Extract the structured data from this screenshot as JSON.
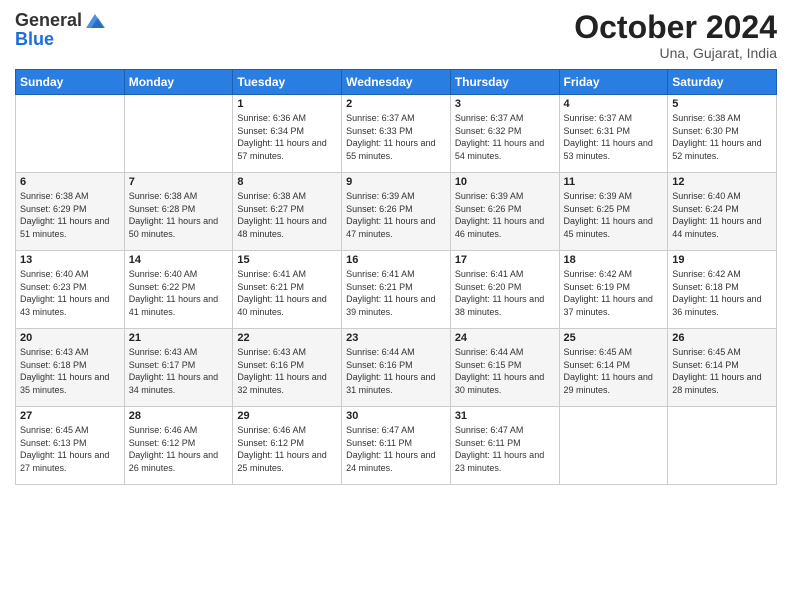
{
  "header": {
    "logo_line1": "General",
    "logo_line2": "Blue",
    "month": "October 2024",
    "location": "Una, Gujarat, India"
  },
  "weekdays": [
    "Sunday",
    "Monday",
    "Tuesday",
    "Wednesday",
    "Thursday",
    "Friday",
    "Saturday"
  ],
  "weeks": [
    [
      {
        "day": "",
        "sunrise": "",
        "sunset": "",
        "daylight": ""
      },
      {
        "day": "",
        "sunrise": "",
        "sunset": "",
        "daylight": ""
      },
      {
        "day": "1",
        "sunrise": "Sunrise: 6:36 AM",
        "sunset": "Sunset: 6:34 PM",
        "daylight": "Daylight: 11 hours and 57 minutes."
      },
      {
        "day": "2",
        "sunrise": "Sunrise: 6:37 AM",
        "sunset": "Sunset: 6:33 PM",
        "daylight": "Daylight: 11 hours and 55 minutes."
      },
      {
        "day": "3",
        "sunrise": "Sunrise: 6:37 AM",
        "sunset": "Sunset: 6:32 PM",
        "daylight": "Daylight: 11 hours and 54 minutes."
      },
      {
        "day": "4",
        "sunrise": "Sunrise: 6:37 AM",
        "sunset": "Sunset: 6:31 PM",
        "daylight": "Daylight: 11 hours and 53 minutes."
      },
      {
        "day": "5",
        "sunrise": "Sunrise: 6:38 AM",
        "sunset": "Sunset: 6:30 PM",
        "daylight": "Daylight: 11 hours and 52 minutes."
      }
    ],
    [
      {
        "day": "6",
        "sunrise": "Sunrise: 6:38 AM",
        "sunset": "Sunset: 6:29 PM",
        "daylight": "Daylight: 11 hours and 51 minutes."
      },
      {
        "day": "7",
        "sunrise": "Sunrise: 6:38 AM",
        "sunset": "Sunset: 6:28 PM",
        "daylight": "Daylight: 11 hours and 50 minutes."
      },
      {
        "day": "8",
        "sunrise": "Sunrise: 6:38 AM",
        "sunset": "Sunset: 6:27 PM",
        "daylight": "Daylight: 11 hours and 48 minutes."
      },
      {
        "day": "9",
        "sunrise": "Sunrise: 6:39 AM",
        "sunset": "Sunset: 6:26 PM",
        "daylight": "Daylight: 11 hours and 47 minutes."
      },
      {
        "day": "10",
        "sunrise": "Sunrise: 6:39 AM",
        "sunset": "Sunset: 6:26 PM",
        "daylight": "Daylight: 11 hours and 46 minutes."
      },
      {
        "day": "11",
        "sunrise": "Sunrise: 6:39 AM",
        "sunset": "Sunset: 6:25 PM",
        "daylight": "Daylight: 11 hours and 45 minutes."
      },
      {
        "day": "12",
        "sunrise": "Sunrise: 6:40 AM",
        "sunset": "Sunset: 6:24 PM",
        "daylight": "Daylight: 11 hours and 44 minutes."
      }
    ],
    [
      {
        "day": "13",
        "sunrise": "Sunrise: 6:40 AM",
        "sunset": "Sunset: 6:23 PM",
        "daylight": "Daylight: 11 hours and 43 minutes."
      },
      {
        "day": "14",
        "sunrise": "Sunrise: 6:40 AM",
        "sunset": "Sunset: 6:22 PM",
        "daylight": "Daylight: 11 hours and 41 minutes."
      },
      {
        "day": "15",
        "sunrise": "Sunrise: 6:41 AM",
        "sunset": "Sunset: 6:21 PM",
        "daylight": "Daylight: 11 hours and 40 minutes."
      },
      {
        "day": "16",
        "sunrise": "Sunrise: 6:41 AM",
        "sunset": "Sunset: 6:21 PM",
        "daylight": "Daylight: 11 hours and 39 minutes."
      },
      {
        "day": "17",
        "sunrise": "Sunrise: 6:41 AM",
        "sunset": "Sunset: 6:20 PM",
        "daylight": "Daylight: 11 hours and 38 minutes."
      },
      {
        "day": "18",
        "sunrise": "Sunrise: 6:42 AM",
        "sunset": "Sunset: 6:19 PM",
        "daylight": "Daylight: 11 hours and 37 minutes."
      },
      {
        "day": "19",
        "sunrise": "Sunrise: 6:42 AM",
        "sunset": "Sunset: 6:18 PM",
        "daylight": "Daylight: 11 hours and 36 minutes."
      }
    ],
    [
      {
        "day": "20",
        "sunrise": "Sunrise: 6:43 AM",
        "sunset": "Sunset: 6:18 PM",
        "daylight": "Daylight: 11 hours and 35 minutes."
      },
      {
        "day": "21",
        "sunrise": "Sunrise: 6:43 AM",
        "sunset": "Sunset: 6:17 PM",
        "daylight": "Daylight: 11 hours and 34 minutes."
      },
      {
        "day": "22",
        "sunrise": "Sunrise: 6:43 AM",
        "sunset": "Sunset: 6:16 PM",
        "daylight": "Daylight: 11 hours and 32 minutes."
      },
      {
        "day": "23",
        "sunrise": "Sunrise: 6:44 AM",
        "sunset": "Sunset: 6:16 PM",
        "daylight": "Daylight: 11 hours and 31 minutes."
      },
      {
        "day": "24",
        "sunrise": "Sunrise: 6:44 AM",
        "sunset": "Sunset: 6:15 PM",
        "daylight": "Daylight: 11 hours and 30 minutes."
      },
      {
        "day": "25",
        "sunrise": "Sunrise: 6:45 AM",
        "sunset": "Sunset: 6:14 PM",
        "daylight": "Daylight: 11 hours and 29 minutes."
      },
      {
        "day": "26",
        "sunrise": "Sunrise: 6:45 AM",
        "sunset": "Sunset: 6:14 PM",
        "daylight": "Daylight: 11 hours and 28 minutes."
      }
    ],
    [
      {
        "day": "27",
        "sunrise": "Sunrise: 6:45 AM",
        "sunset": "Sunset: 6:13 PM",
        "daylight": "Daylight: 11 hours and 27 minutes."
      },
      {
        "day": "28",
        "sunrise": "Sunrise: 6:46 AM",
        "sunset": "Sunset: 6:12 PM",
        "daylight": "Daylight: 11 hours and 26 minutes."
      },
      {
        "day": "29",
        "sunrise": "Sunrise: 6:46 AM",
        "sunset": "Sunset: 6:12 PM",
        "daylight": "Daylight: 11 hours and 25 minutes."
      },
      {
        "day": "30",
        "sunrise": "Sunrise: 6:47 AM",
        "sunset": "Sunset: 6:11 PM",
        "daylight": "Daylight: 11 hours and 24 minutes."
      },
      {
        "day": "31",
        "sunrise": "Sunrise: 6:47 AM",
        "sunset": "Sunset: 6:11 PM",
        "daylight": "Daylight: 11 hours and 23 minutes."
      },
      {
        "day": "",
        "sunrise": "",
        "sunset": "",
        "daylight": ""
      },
      {
        "day": "",
        "sunrise": "",
        "sunset": "",
        "daylight": ""
      }
    ]
  ]
}
